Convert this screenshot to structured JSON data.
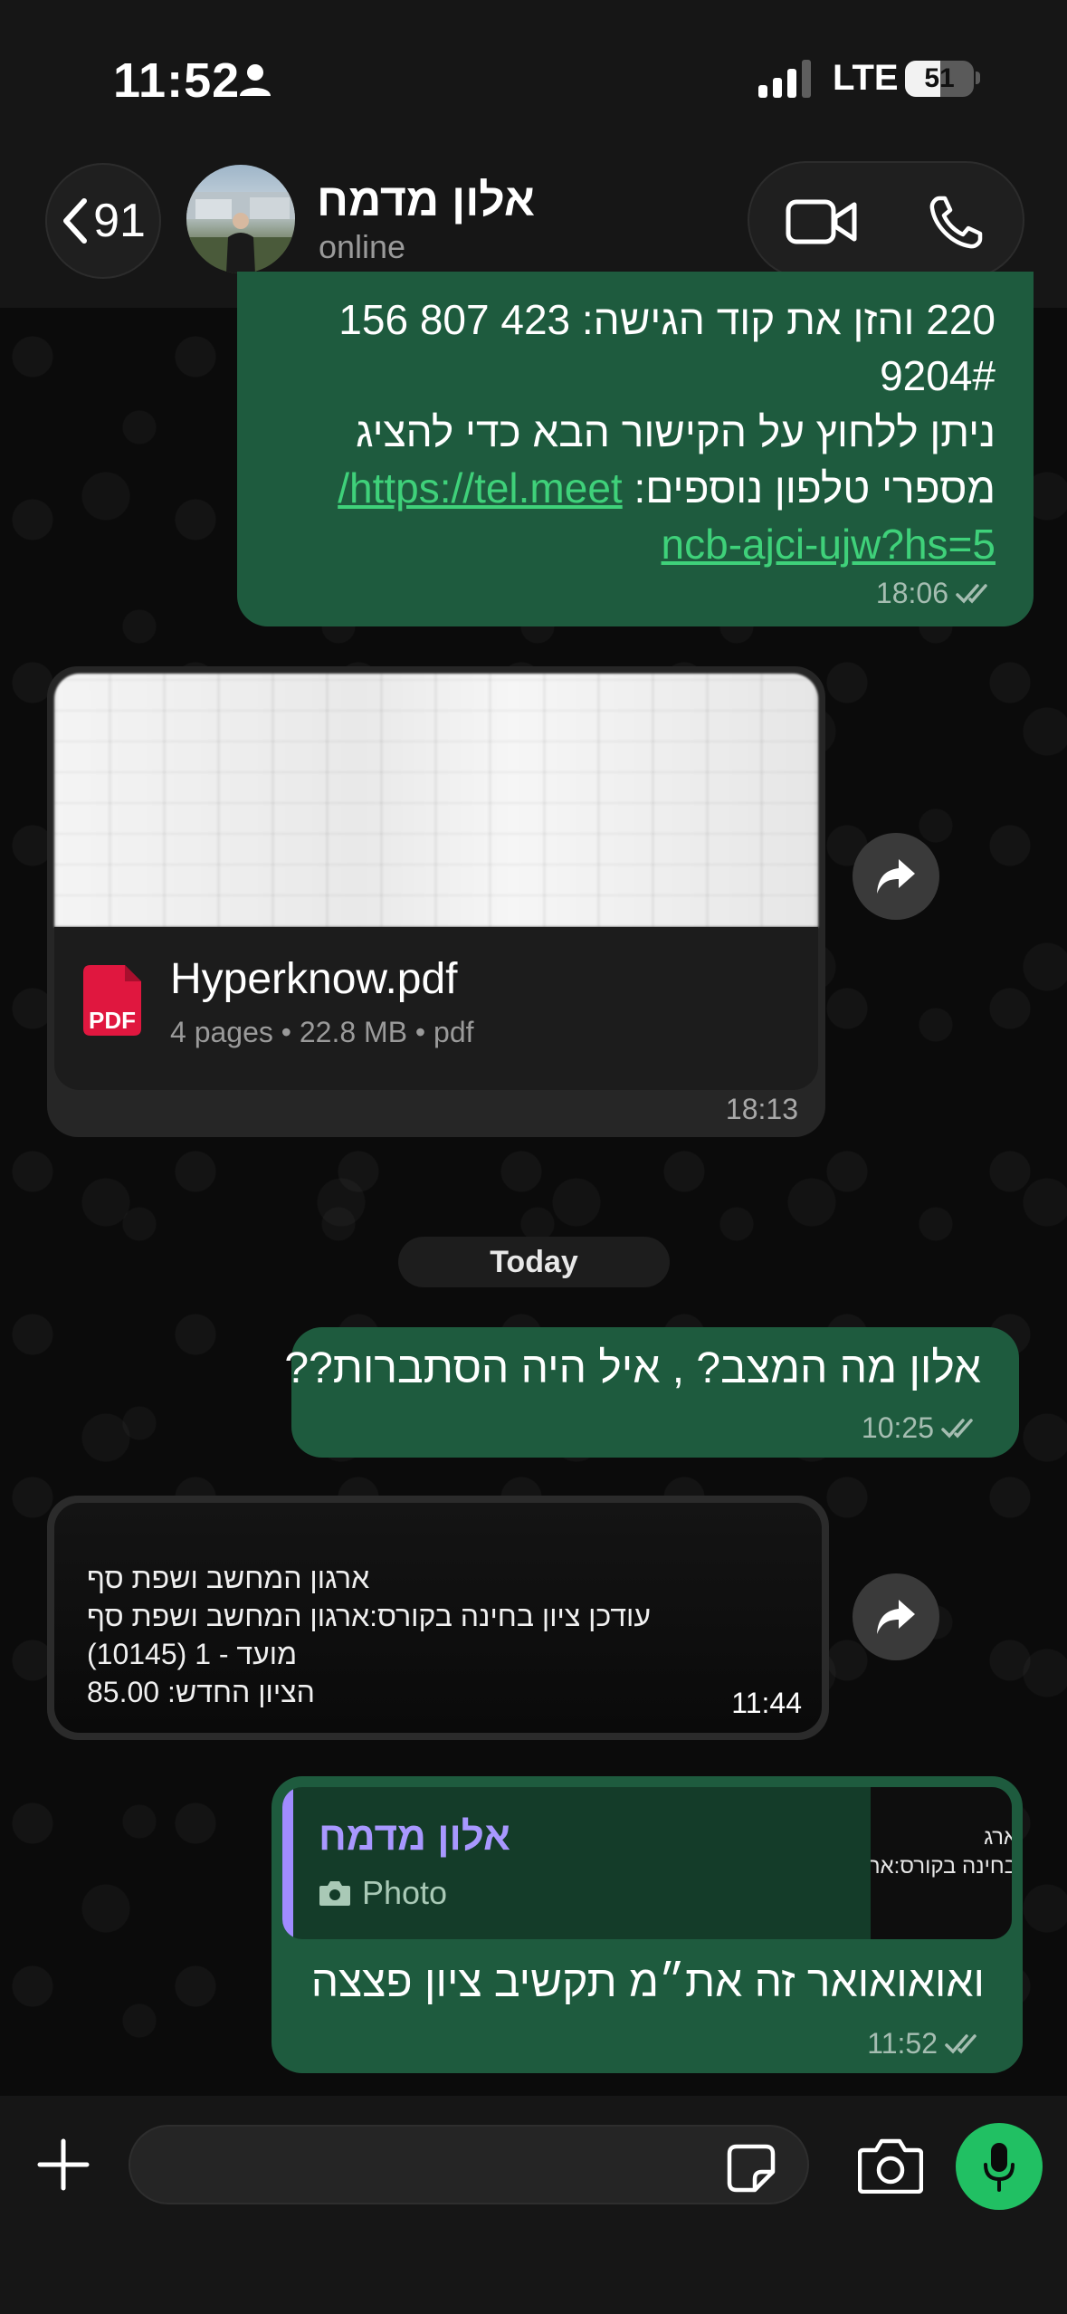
{
  "status_bar": {
    "time": "11:52",
    "network": "LTE",
    "battery": "51"
  },
  "header": {
    "back_count": "91",
    "contact_name": "אלון מדמח",
    "contact_status": "online"
  },
  "messages": [
    {
      "type": "outgoing-text",
      "lines": [
        "220 והזן את קוד הגישה: 423 807 156",
        "9204#",
        "ניתן ללחוץ על הקישור הבא כדי להציג"
      ],
      "line4_text": "מספרי טלפון נוספים:",
      "link_part1": "https://tel.meet/",
      "link_part2": "ncb-ajci-ujw?hs=5",
      "time": "18:06"
    },
    {
      "type": "incoming-document",
      "file_name": "Hyperknow.pdf",
      "file_details": "4 pages • 22.8 MB • pdf",
      "icon_label": "PDF",
      "time": "18:13"
    },
    {
      "type": "date-divider",
      "label": "Today"
    },
    {
      "type": "outgoing-text",
      "text": "אלון מה המצב? , איל היה הסתברות??",
      "time": "10:25"
    },
    {
      "type": "incoming-image",
      "image_text": [
        "ארגון המחשב ושפת סף",
        "עודכן ציון בחינה בקורס:ארגון המחשב ושפת סף",
        "מועד - 1 (10145)",
        "הציון החדש: 85.00"
      ],
      "time": "11:44"
    },
    {
      "type": "outgoing-reply",
      "quoted_name": "אלון מדמח",
      "quoted_type": "Photo",
      "quoted_thumb_text": [
        "ארג",
        "בחינה בקורס:ארג"
      ],
      "text": "ואואואואר זה את״מ תקשיב ציון פצצה",
      "time": "11:52"
    }
  ],
  "input": {
    "placeholder": "",
    "value": ""
  },
  "colors": {
    "outgoing_bubble": "#1e5b3e",
    "incoming_bubble": "#262626",
    "accent_green": "#21c063",
    "link": "#3fd17a",
    "quote_name": "#a898ff"
  }
}
